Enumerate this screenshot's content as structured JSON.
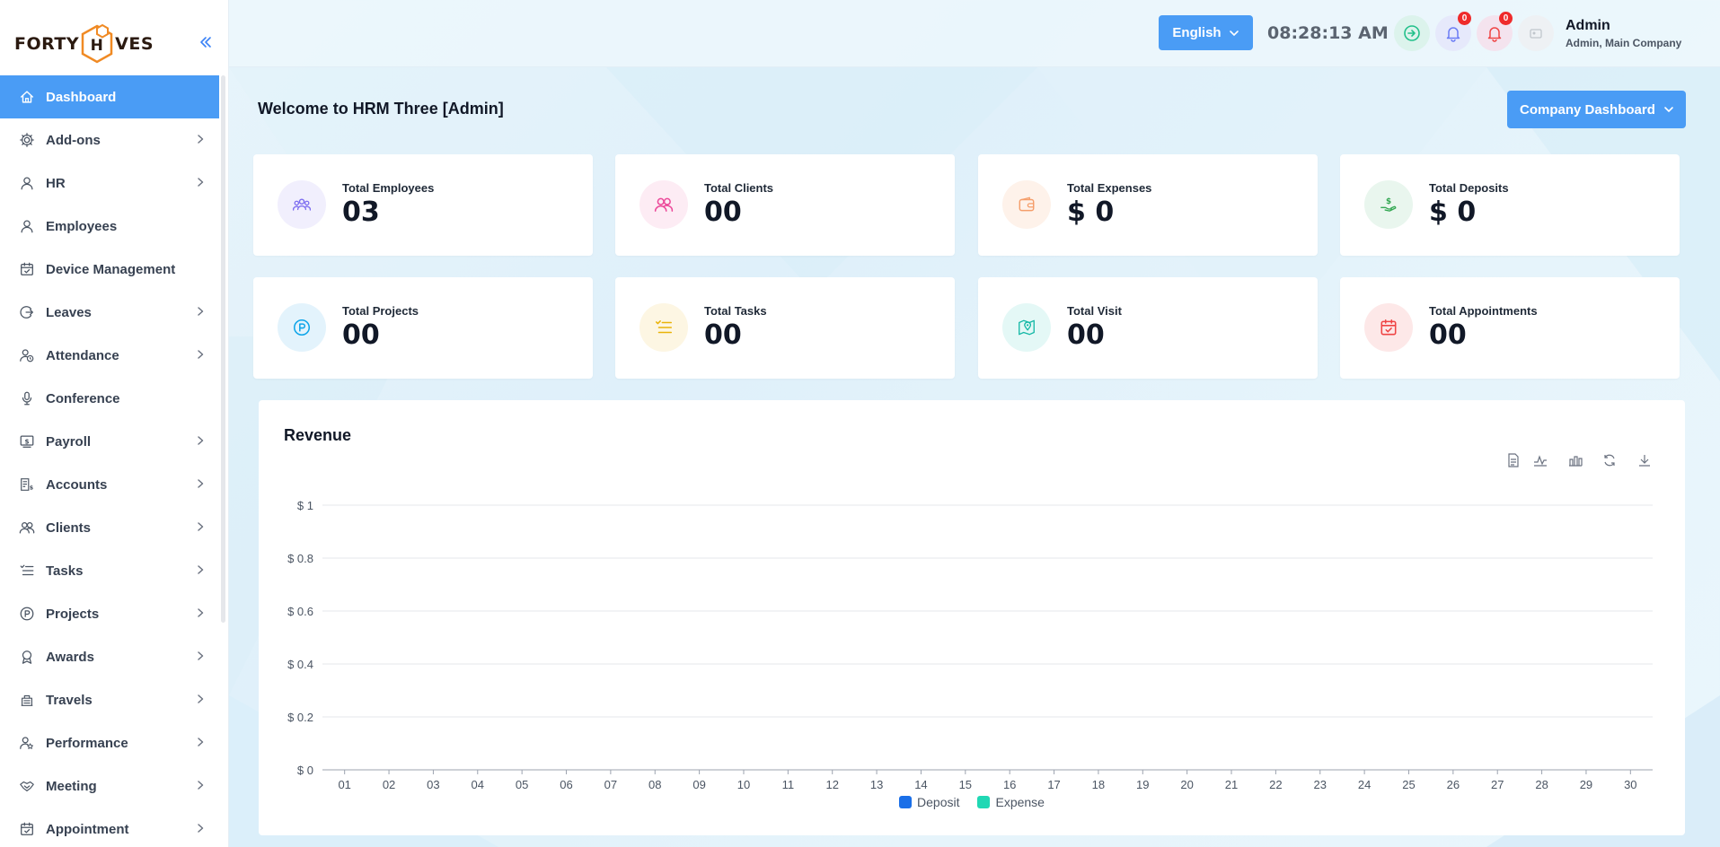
{
  "app": {
    "logo_text_left": "FORTY",
    "logo_text_right": "VES",
    "logo_hex_letter": "H"
  },
  "sidebar": {
    "items": [
      {
        "label": "Dashboard",
        "icon": "home-icon",
        "active": true,
        "has_children": false
      },
      {
        "label": "Add-ons",
        "icon": "gear-icon",
        "active": false,
        "has_children": true
      },
      {
        "label": "HR",
        "icon": "user-icon",
        "active": false,
        "has_children": true
      },
      {
        "label": "Employees",
        "icon": "user-icon",
        "active": false,
        "has_children": false
      },
      {
        "label": "Device Management",
        "icon": "calendar-check-icon",
        "active": false,
        "has_children": false
      },
      {
        "label": "Leaves",
        "icon": "leave-icon",
        "active": false,
        "has_children": true
      },
      {
        "label": "Attendance",
        "icon": "user-clock-icon",
        "active": false,
        "has_children": true
      },
      {
        "label": "Conference",
        "icon": "microphone-icon",
        "active": false,
        "has_children": false
      },
      {
        "label": "Payroll",
        "icon": "payroll-icon",
        "active": false,
        "has_children": true
      },
      {
        "label": "Accounts",
        "icon": "accounts-icon",
        "active": false,
        "has_children": true
      },
      {
        "label": "Clients",
        "icon": "users-icon",
        "active": false,
        "has_children": true
      },
      {
        "label": "Tasks",
        "icon": "checklist-icon",
        "active": false,
        "has_children": true
      },
      {
        "label": "Projects",
        "icon": "project-p-icon",
        "active": false,
        "has_children": true
      },
      {
        "label": "Awards",
        "icon": "award-icon",
        "active": false,
        "has_children": true
      },
      {
        "label": "Travels",
        "icon": "travel-icon",
        "active": false,
        "has_children": true
      },
      {
        "label": "Performance",
        "icon": "performance-icon",
        "active": false,
        "has_children": true
      },
      {
        "label": "Meeting",
        "icon": "handshake-icon",
        "active": false,
        "has_children": true
      },
      {
        "label": "Appointment",
        "icon": "calendar-check-icon",
        "active": false,
        "has_children": true
      }
    ]
  },
  "topbar": {
    "language": "English",
    "clock": "08:28:13 AM",
    "notifications_count": "0",
    "alerts_count": "0",
    "user_name": "Admin",
    "user_role": "Admin, Main Company"
  },
  "main": {
    "welcome": "Welcome to HRM Three [Admin]",
    "dashboard_select": "Company Dashboard",
    "stats": [
      {
        "label": "Total Employees",
        "value": "03",
        "icon": "team-icon",
        "color": "#7c6cf0",
        "bg": "#f1effd"
      },
      {
        "label": "Total Clients",
        "value": "00",
        "icon": "users-icon",
        "color": "#ec4899",
        "bg": "#fdecf4"
      },
      {
        "label": "Total Expenses",
        "value": "$ 0",
        "icon": "wallet-icon",
        "color": "#f59e6b",
        "bg": "#fef2ea"
      },
      {
        "label": "Total Deposits",
        "value": "$ 0",
        "icon": "deposit-hand-icon",
        "color": "#34a853",
        "bg": "#e9f6ee"
      },
      {
        "label": "Total Projects",
        "value": "00",
        "icon": "project-p-icon",
        "color": "#0ea5e9",
        "bg": "#e3f3fc"
      },
      {
        "label": "Total Tasks",
        "value": "00",
        "icon": "checklist-icon",
        "color": "#eab308",
        "bg": "#fdf6e3"
      },
      {
        "label": "Total Visit",
        "value": "00",
        "icon": "map-pin-icon",
        "color": "#14b8a6",
        "bg": "#e4f8f6"
      },
      {
        "label": "Total Appointments",
        "value": "00",
        "icon": "calendar-check-icon",
        "color": "#ef4444",
        "bg": "#fde8e8"
      }
    ]
  },
  "revenue": {
    "title": "Revenue",
    "toolbar": [
      "document-icon",
      "line-chart-icon",
      "bar-chart-icon",
      "refresh-icon",
      "download-icon"
    ]
  },
  "chart_data": {
    "type": "line",
    "title": "Revenue",
    "xlabel": "",
    "ylabel": "",
    "x": [
      "01",
      "02",
      "03",
      "04",
      "05",
      "06",
      "07",
      "08",
      "09",
      "10",
      "11",
      "12",
      "13",
      "14",
      "15",
      "16",
      "17",
      "18",
      "19",
      "20",
      "21",
      "22",
      "23",
      "24",
      "25",
      "26",
      "27",
      "28",
      "29",
      "30"
    ],
    "y_ticks": [
      "$ 0",
      "$ 0.2",
      "$ 0.4",
      "$ 0.6",
      "$ 0.8",
      "$ 1"
    ],
    "ylim": [
      0,
      1
    ],
    "grid": true,
    "legend_placement": "bottom-center",
    "series": [
      {
        "name": "Deposit",
        "color": "#1a6fe8",
        "values": [
          0,
          0,
          0,
          0,
          0,
          0,
          0,
          0,
          0,
          0,
          0,
          0,
          0,
          0,
          0,
          0,
          0,
          0,
          0,
          0,
          0,
          0,
          0,
          0,
          0,
          0,
          0,
          0,
          0,
          0
        ]
      },
      {
        "name": "Expense",
        "color": "#20d8b4",
        "values": [
          0,
          0,
          0,
          0,
          0,
          0,
          0,
          0,
          0,
          0,
          0,
          0,
          0,
          0,
          0,
          0,
          0,
          0,
          0,
          0,
          0,
          0,
          0,
          0,
          0,
          0,
          0,
          0,
          0,
          0
        ]
      }
    ]
  }
}
